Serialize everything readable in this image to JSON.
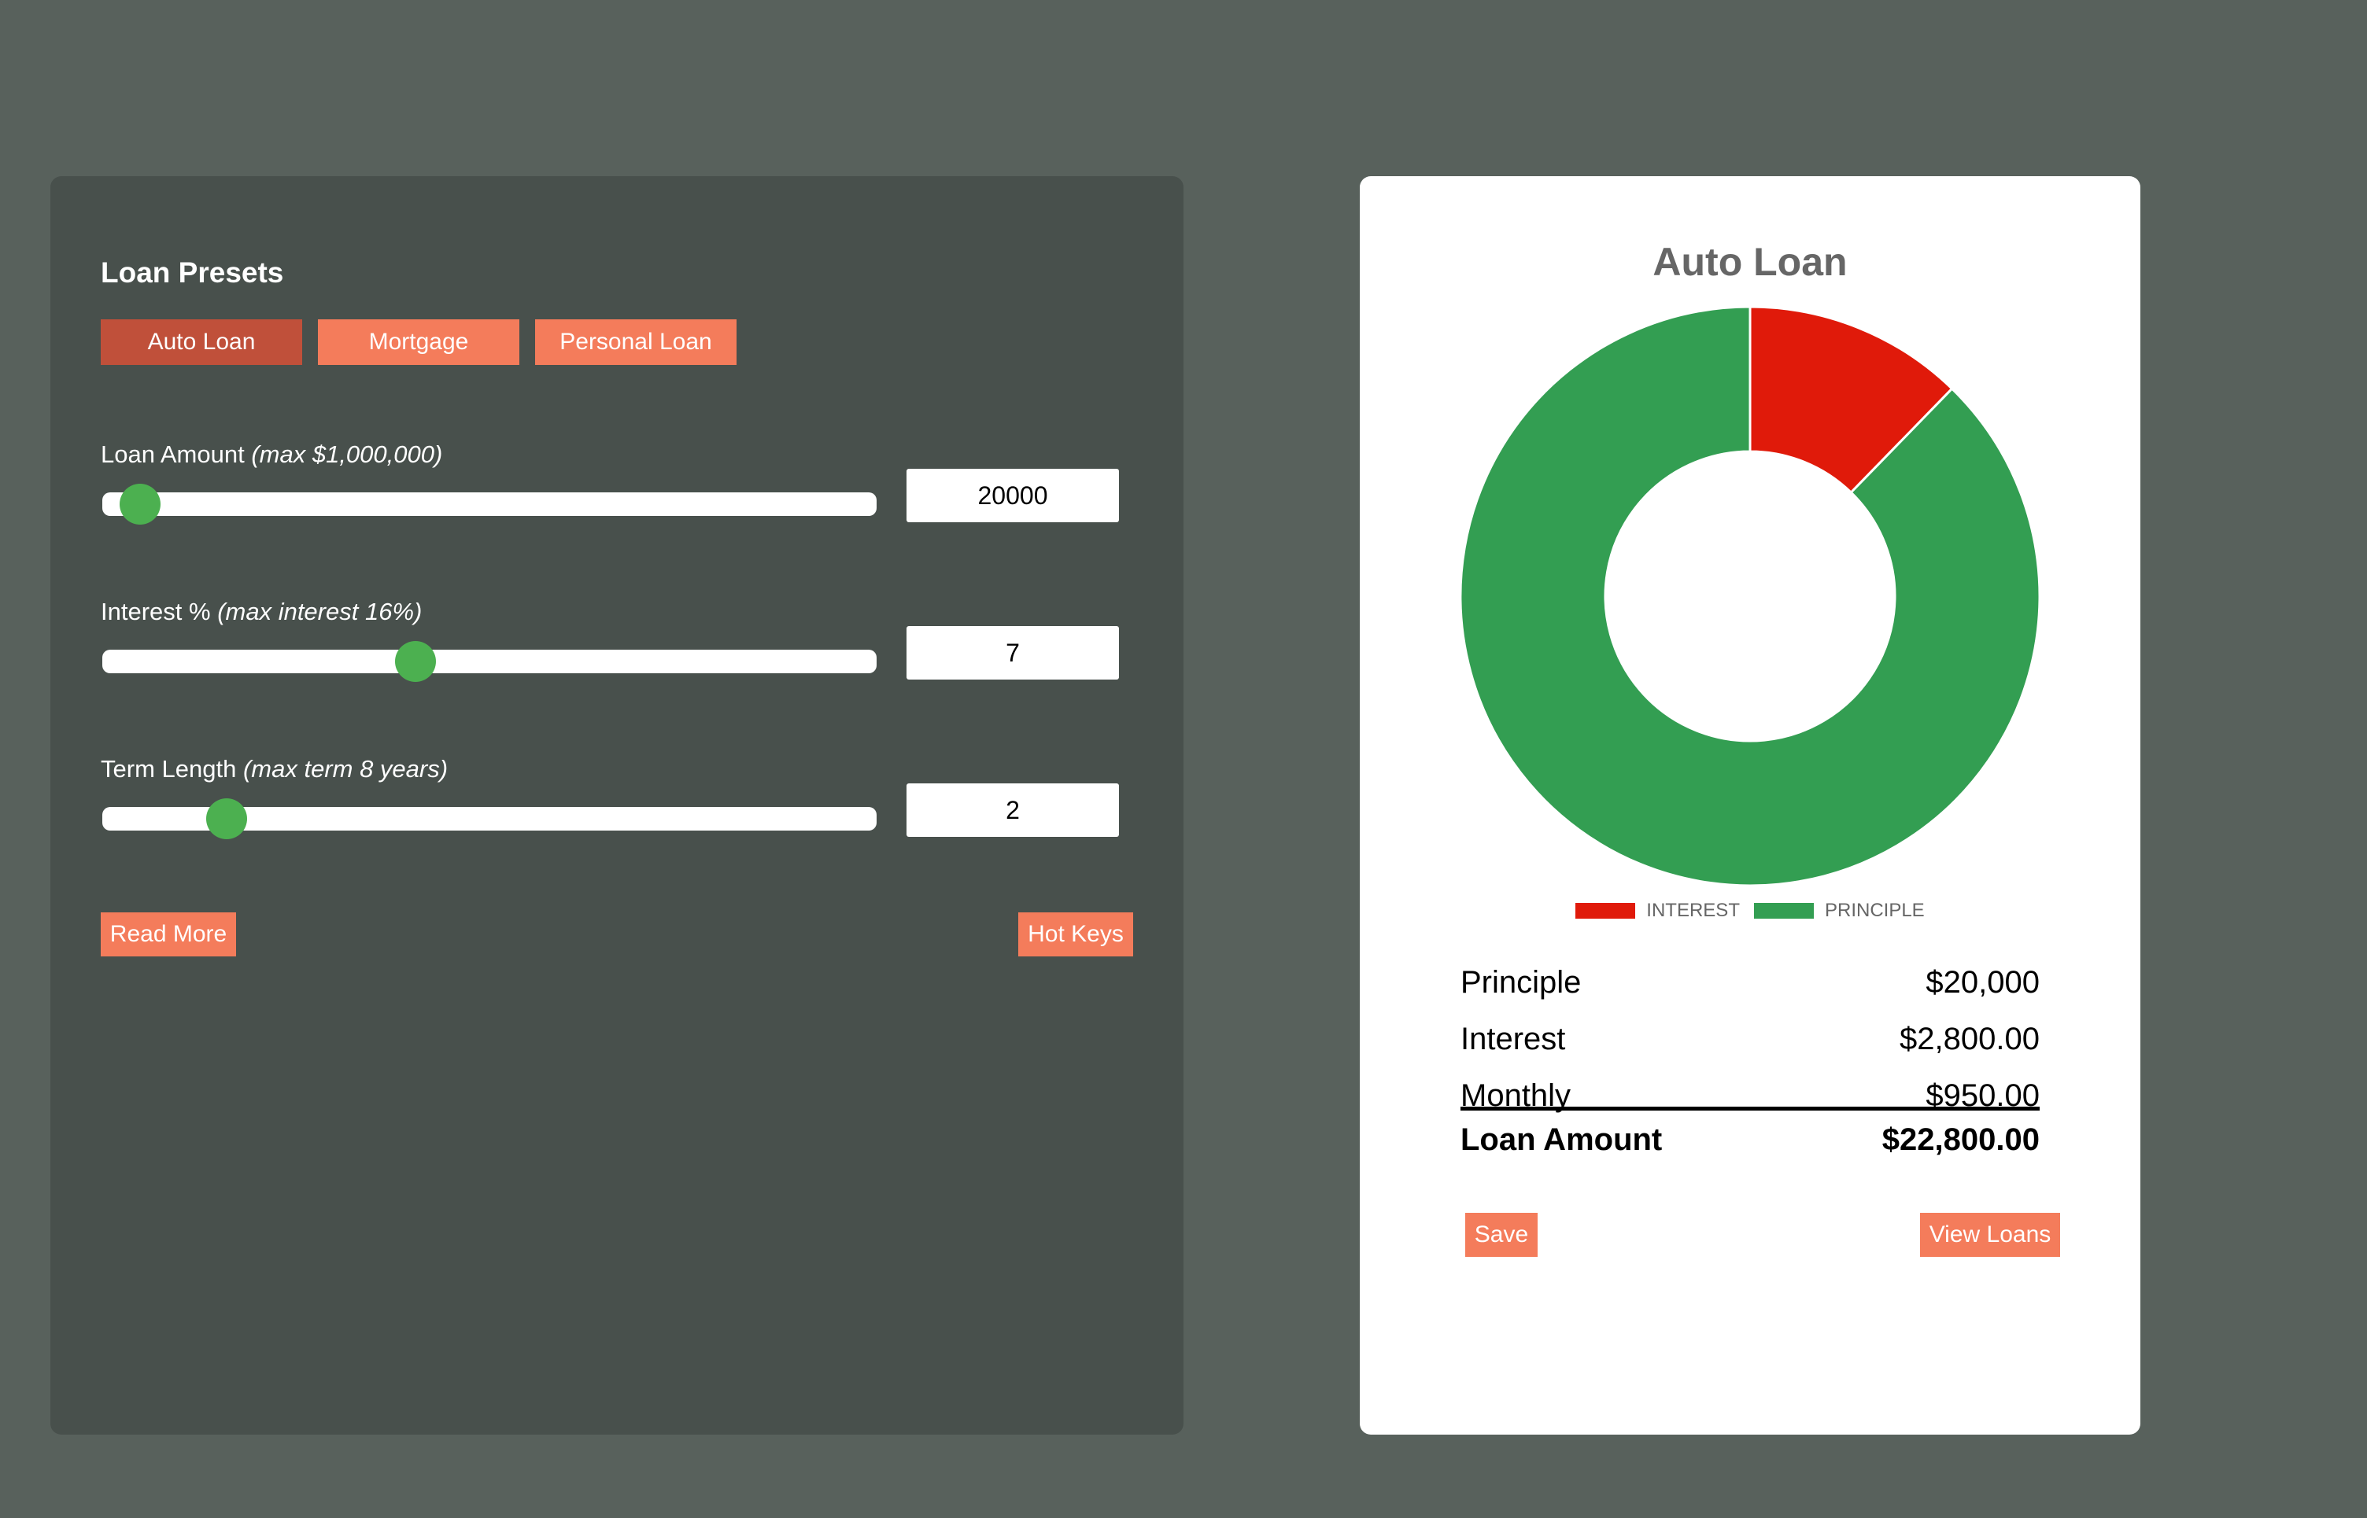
{
  "presets": {
    "title": "Loan Presets",
    "buttons": [
      "Auto Loan",
      "Mortgage",
      "Personal Loan"
    ],
    "active": "Auto Loan"
  },
  "sliders": [
    {
      "label": "Loan Amount",
      "hint": "(max $1,000,000)",
      "value": "20000",
      "fraction": 0.02
    },
    {
      "label": "Interest %",
      "hint": "(max interest 16%)",
      "value": "7",
      "fraction": 0.4375
    },
    {
      "label": "Term Length",
      "hint": "(max term 8 years)",
      "value": "2",
      "fraction": 0.25
    }
  ],
  "actions": {
    "read_more": "Read More",
    "hot_keys": "Hot Keys"
  },
  "summary": {
    "principle_label": "Principle",
    "principle_value": "$20,000",
    "interest_label": "Interest",
    "interest_value": "$2,800.00",
    "monthly_label": "Monthly",
    "monthly_value": "$950.00",
    "total_label": "Loan Amount",
    "total_value": "$22,800.00",
    "save": "Save",
    "view_loans": "View Loans"
  },
  "colors": {
    "interest": "#e01a0a",
    "principle": "#339e52"
  },
  "chart_data": {
    "type": "pie",
    "title": "Auto Loan",
    "categories": [
      "INTEREST",
      "PRINCIPLE"
    ],
    "values": [
      2800,
      20000
    ],
    "legend": "bottom"
  }
}
